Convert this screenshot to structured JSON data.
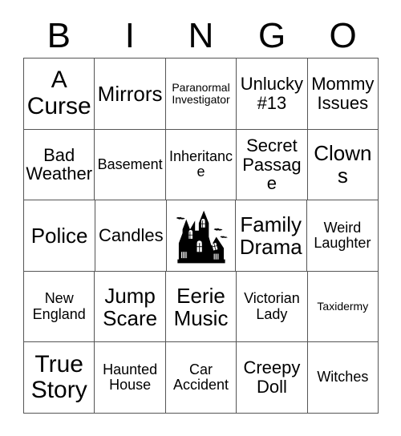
{
  "card": {
    "title_letters": [
      "B",
      "I",
      "N",
      "G",
      "O"
    ],
    "columns": 5,
    "rows": 5,
    "border_color": "#555555",
    "text_color": "#000000",
    "background_color": "#ffffff",
    "free_space": {
      "position": "row-3-column-3",
      "icon": "haunted-house-icon",
      "description": "Black silhouette haunted house with pointed spires, lit windows and bats",
      "color": "#000000"
    },
    "squares": [
      [
        {
          "label": "A Curse",
          "size": "fs-xl"
        },
        {
          "label": "Mirrors",
          "size": "fs-lg"
        },
        {
          "label": "Paranormal Investigator",
          "size": "fs-xs"
        },
        {
          "label": "Unlucky #13",
          "size": "fs-md"
        },
        {
          "label": "Mommy Issues",
          "size": "fs-md"
        }
      ],
      [
        {
          "label": "Bad Weather",
          "size": "fs-md"
        },
        {
          "label": "Basement",
          "size": "fs-sm"
        },
        {
          "label": "Inheritance",
          "size": "fs-sm"
        },
        {
          "label": "Secret Passage",
          "size": "fs-md"
        },
        {
          "label": "Clowns",
          "size": "fs-lg"
        }
      ],
      [
        {
          "label": "Police",
          "size": "fs-lg"
        },
        {
          "label": "Candles",
          "size": "fs-md"
        },
        {
          "label": "",
          "size": "free"
        },
        {
          "label": "Family Drama",
          "size": "fs-lg"
        },
        {
          "label": "Weird Laughter",
          "size": "fs-sm"
        }
      ],
      [
        {
          "label": "New England",
          "size": "fs-sm"
        },
        {
          "label": "Jump Scare",
          "size": "fs-lg"
        },
        {
          "label": "Eerie Music",
          "size": "fs-lg"
        },
        {
          "label": "Victorian Lady",
          "size": "fs-sm"
        },
        {
          "label": "Taxidermy",
          "size": "fs-xs"
        }
      ],
      [
        {
          "label": "True Story",
          "size": "fs-xl"
        },
        {
          "label": "Haunted House",
          "size": "fs-sm"
        },
        {
          "label": "Car Accident",
          "size": "fs-sm"
        },
        {
          "label": "Creepy Doll",
          "size": "fs-md"
        },
        {
          "label": "Witches",
          "size": "fs-sm"
        }
      ]
    ]
  }
}
